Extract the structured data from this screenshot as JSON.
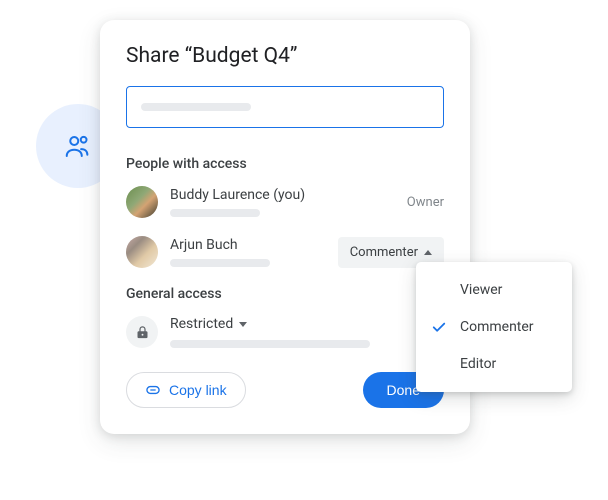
{
  "dialog": {
    "title": "Share “Budget Q4”"
  },
  "sections": {
    "people_label": "People with access",
    "general_label": "General access"
  },
  "people": [
    {
      "name": "Buddy Laurence (you)",
      "role": "Owner"
    },
    {
      "name": "Arjun Buch",
      "role": "Commenter"
    }
  ],
  "general": {
    "mode": "Restricted"
  },
  "footer": {
    "copy": "Copy link",
    "done": "Done"
  },
  "dropdown": {
    "options": [
      "Viewer",
      "Commenter",
      "Editor"
    ],
    "selected": "Commenter"
  },
  "colors": {
    "primary": "#1a73e8",
    "text": "#3c4043",
    "muted": "#80868b"
  }
}
